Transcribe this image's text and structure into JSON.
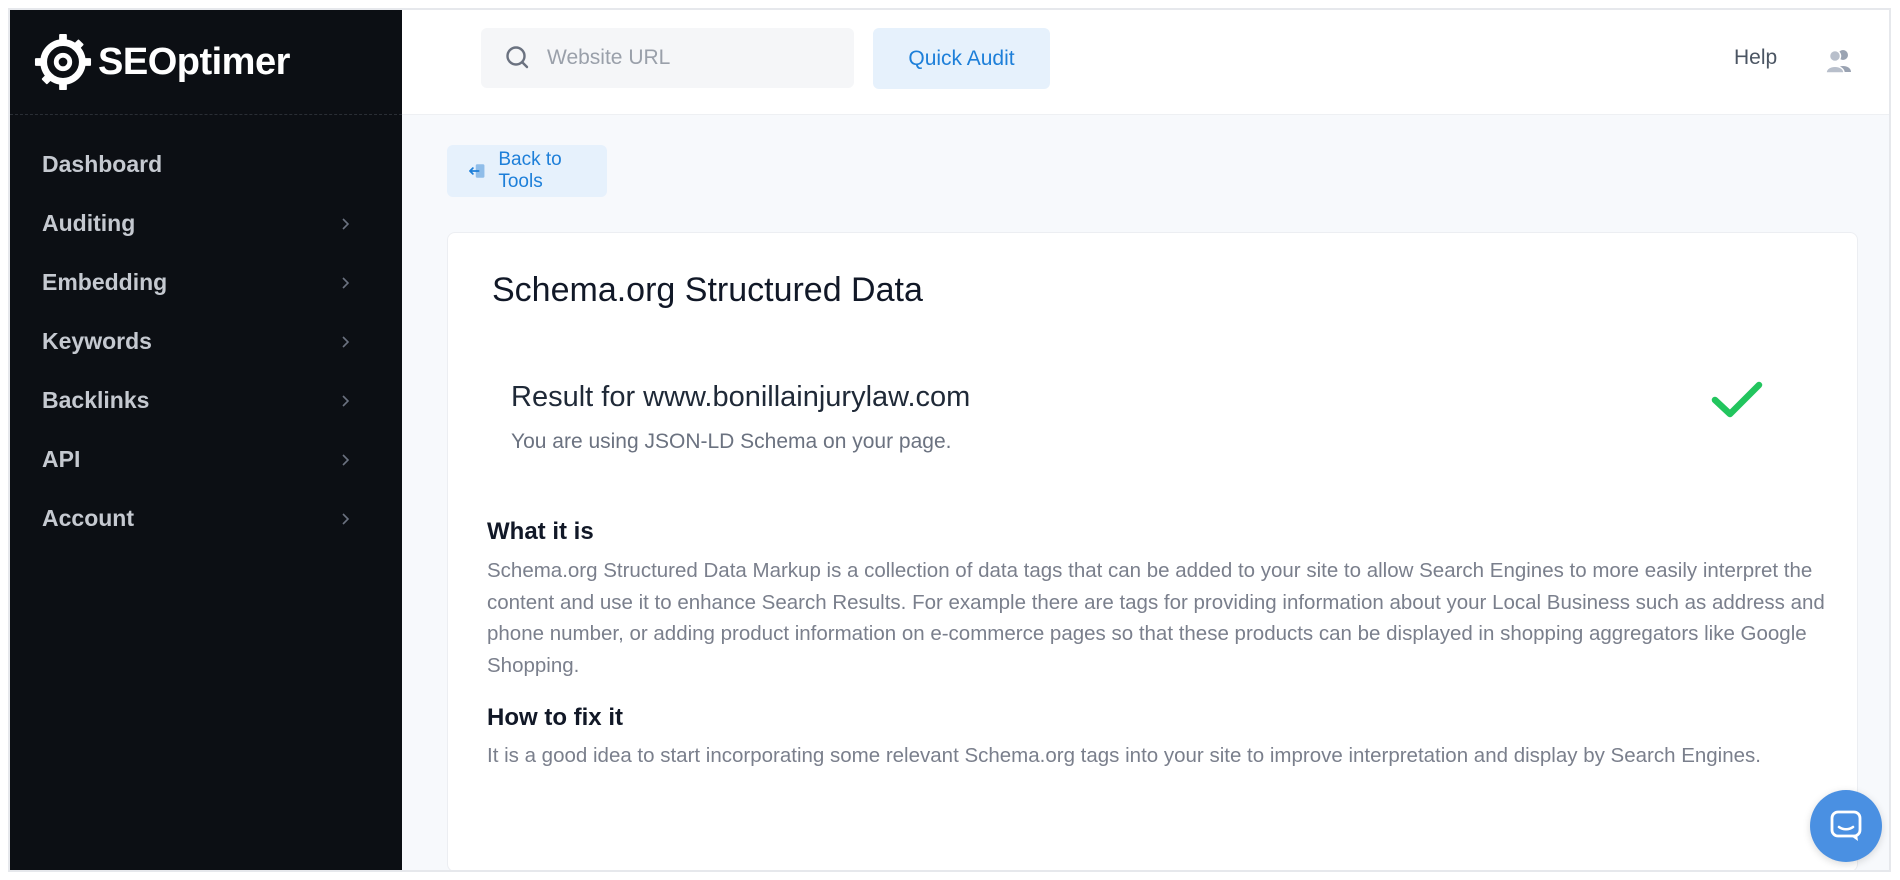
{
  "brand": {
    "name": "SEOptimer",
    "icon": "gear-logo-icon"
  },
  "sidebar": {
    "items": [
      {
        "label": "Dashboard",
        "has_chevron": false
      },
      {
        "label": "Auditing",
        "has_chevron": true
      },
      {
        "label": "Embedding",
        "has_chevron": true
      },
      {
        "label": "Keywords",
        "has_chevron": true
      },
      {
        "label": "Backlinks",
        "has_chevron": true
      },
      {
        "label": "API",
        "has_chevron": true
      },
      {
        "label": "Account",
        "has_chevron": true
      }
    ]
  },
  "topbar": {
    "search_placeholder": "Website URL",
    "quick_audit_label": "Quick Audit",
    "help_label": "Help"
  },
  "back_button": {
    "label": "Back to Tools"
  },
  "card": {
    "title": "Schema.org Structured Data",
    "result": {
      "title": "Result for www.bonillainjurylaw.com",
      "subtitle": "You are using JSON-LD Schema on your page.",
      "status_icon": "check-icon",
      "status_color": "#22c55e"
    },
    "what_it_is": {
      "heading": "What it is",
      "text": "Schema.org Structured Data Markup is a collection of data tags that can be added to your site to allow Search Engines to more easily interpret the content and use it to enhance Search Results. For example there are tags for providing information about your Local Business such as address and phone number, or adding product information on e-commerce pages so that these products can be displayed in shopping aggregators like Google Shopping."
    },
    "how_to_fix": {
      "heading": "How to fix it",
      "text": "It is a good idea to start incorporating some relevant Schema.org tags into your site to improve interpretation and display by Search Engines."
    }
  },
  "colors": {
    "sidebar_bg": "#0c0f14",
    "accent": "#1d7fd9",
    "accent_bg": "#e6f1fc",
    "chat_bubble": "#4a90e2"
  }
}
